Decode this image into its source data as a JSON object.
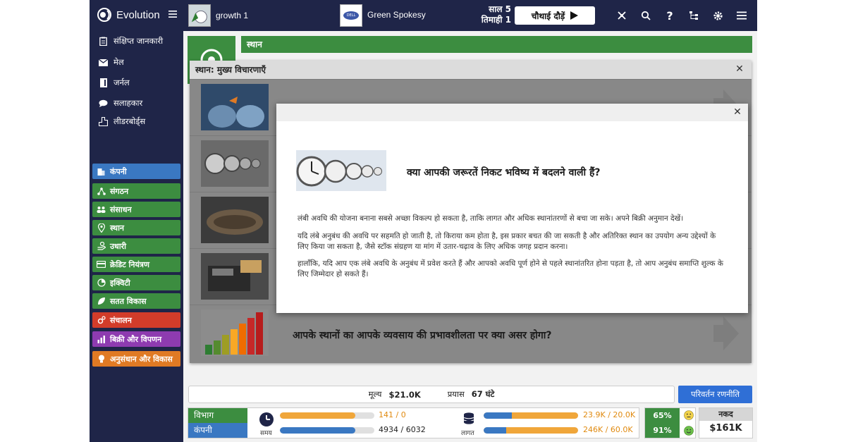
{
  "topbar": {
    "app_name": "Evolution",
    "company_name": "growth 1",
    "rival_name": "Green Spokesy",
    "rival_logo_text": "DELL",
    "year": "साल 5",
    "quarter": "तिमाही 1",
    "run_button": "चौथाई दौड़ें"
  },
  "sidebar": {
    "links": [
      "संक्षिप्त जानकारी",
      "मेल",
      "जर्नल",
      "सलाहकार",
      "लीडरबोर्ड्स"
    ],
    "modules": [
      {
        "label": "कंपनी",
        "color": "#3a78c2"
      },
      {
        "label": "संगठन",
        "color": "#3c8d40"
      },
      {
        "label": "संसाधन",
        "color": "#3c8d40"
      },
      {
        "label": "स्थान",
        "color": "#3c8d40"
      },
      {
        "label": "उधारी",
        "color": "#3c8d40"
      },
      {
        "label": "क्रेडिट नियंत्रण",
        "color": "#3c8d40"
      },
      {
        "label": "इक्विटी",
        "color": "#3c8d40"
      },
      {
        "label": "सतत विकास",
        "color": "#3c8d40"
      },
      {
        "label": "संचालन",
        "color": "#d23c2a"
      },
      {
        "label": "बिक्री और विपणन",
        "color": "#8e3bb0"
      },
      {
        "label": "अनुसंधान और विकास",
        "color": "#e07a24"
      }
    ]
  },
  "background": {
    "section_title": "स्थान"
  },
  "modal": {
    "title": "स्थान: मुख्य विचारणाएँ",
    "last_row_title": "आपके स्थानों का आपके व्यवसाय की प्रभावशीलता पर क्या असर होगा?"
  },
  "dialog": {
    "question": "क्या आपकी जरूरतें निकट भविष्य में बदलने वाली हैं?",
    "paragraphs": [
      "लंबी अवधि की योजना बनाना सबसे अच्छा विकल्प हो सकता है, ताकि लागत और अधिक स्थानांतरणों से बचा जा सके। अपने बिक्री अनुमान देखें।",
      "यदि लंबे अनुबंध की अवधि पर सहमति हो जाती है, तो किराया कम होता है, इस प्रकार बचत की जा सकती है और अतिरिक्त स्थान का उपयोग अन्य उद्देश्यों के लिए किया जा सकता है, जैसे स्टॉक संग्रहण या मांग में उतार-चढ़ाव के लिए अधिक जगह प्रदान करना।",
      "हालाँकि, यदि आप एक लंबे अवधि के अनुबंध में प्रवेश करते हैं और आपको अवधि पूर्ण होने से पहले स्थानांतरित होना पड़ता है, तो आप अनुबंध समाप्ति शुल्क के लिए जिम्मेदार हो सकते हैं।"
    ]
  },
  "footer": {
    "cost_label": "मूल्य",
    "cost_value": "$21.0K",
    "effort_label": "प्रयास",
    "effort_value": "67 घंटे",
    "change_button": "परिवर्तन रणनीति",
    "dept_label": "विभाग",
    "company_label": "कंपनी",
    "time_label": "समय",
    "cost_stat_label": "लागत",
    "time_dept": "141 / 0",
    "time_company": "4934 / 6032",
    "cost_dept": "23.9K / 20.0K",
    "cost_company": "246K / 60.0K",
    "time_dept_fill": 0.8,
    "time_company_fill": 0.8,
    "cost_dept_fill": 1.0,
    "cost_company_fill": 1.0,
    "pct_dept": "65%",
    "pct_company": "91%",
    "cash_label": "नकद",
    "cash_value": "$161K"
  },
  "colors": {
    "navy": "#1f2548",
    "green": "#3c8d40",
    "blue": "#3a78c2",
    "orange": "#f0a63a"
  }
}
